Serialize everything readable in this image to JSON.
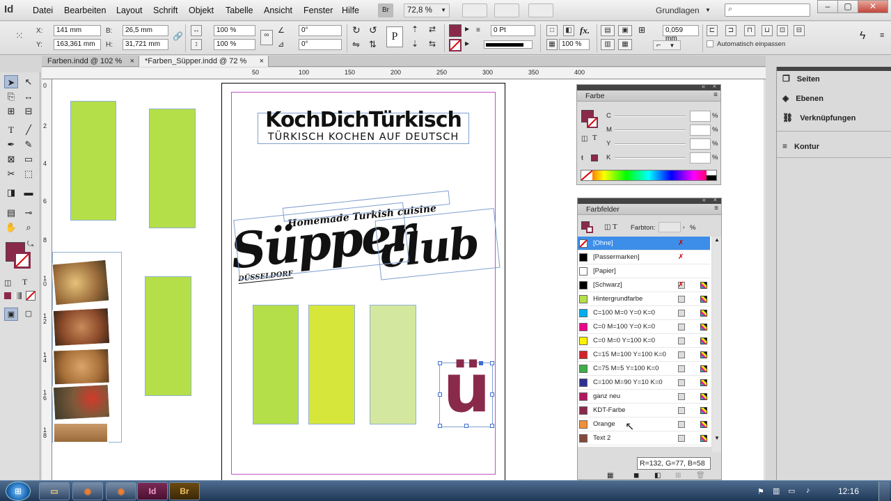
{
  "app": {
    "logo": "Id"
  },
  "menu": [
    "Datei",
    "Bearbeiten",
    "Layout",
    "Schrift",
    "Objekt",
    "Tabelle",
    "Ansicht",
    "Fenster",
    "Hilfe"
  ],
  "menubar": {
    "bridge_label": "Br",
    "zoom": "72,8 %",
    "workspace": "Grundlagen",
    "search_placeholder": ""
  },
  "control": {
    "x_label": "X:",
    "x_value": "141 mm",
    "y_label": "Y:",
    "y_value": "163,361 mm",
    "w_label": "B:",
    "w_value": "26,5 mm",
    "h_label": "H:",
    "h_value": "31,721 mm",
    "scale_x": "100 %",
    "scale_y": "100 %",
    "angle": "0°",
    "shear": "0°",
    "stroke_weight": "0 Pt",
    "opacity": "100 %",
    "offset": "0,059 mm",
    "autofit_label": "Automatisch einpassen"
  },
  "tabs": [
    {
      "label": "Farben.indd @ 102 %"
    },
    {
      "label": "*Farben_Süpper.indd @ 72 %"
    }
  ],
  "ruler_top": [
    "50",
    "100",
    "150",
    "200",
    "250",
    "300",
    "350",
    "400"
  ],
  "ruler_left": [
    "0",
    "2",
    "4",
    "6",
    "8",
    "1 0",
    "1 2",
    "1 4",
    "1 6",
    "1 8"
  ],
  "document": {
    "title": "KochDichTürkisch",
    "subtitle": "TÜRKISCH KOCHEN AUF DEUTSCH",
    "tagline": "Homemade Turkish cuisine",
    "logo_main": "Süpper",
    "logo_sub": "club",
    "city": "DÜSSELDORF",
    "glyph": "ü"
  },
  "color_panel": {
    "title": "Farbe",
    "channels": [
      "C",
      "M",
      "Y",
      "K"
    ],
    "percent": "%"
  },
  "swatches_panel": {
    "title": "Farbfelder",
    "tint_label": "Farbton:",
    "tint_unit": "%",
    "tooltip": "R=132, G=77, B=58",
    "items": [
      {
        "name": "[Ohne]",
        "color": "#ffffff",
        "selected": true
      },
      {
        "name": "[Passermarken]",
        "color": "#000000"
      },
      {
        "name": "[Papier]",
        "color": "#ffffff"
      },
      {
        "name": "[Schwarz]",
        "color": "#000000"
      },
      {
        "name": "Hintergrundfarbe",
        "color": "#b5df48"
      },
      {
        "name": "C=100 M=0 Y=0 K=0",
        "color": "#00aeef"
      },
      {
        "name": "C=0 M=100 Y=0 K=0",
        "color": "#ec008c"
      },
      {
        "name": "C=0 M=0 Y=100 K=0",
        "color": "#fff200"
      },
      {
        "name": "C=15 M=100 Y=100 K=0",
        "color": "#d2232a"
      },
      {
        "name": "C=75 M=5 Y=100 K=0",
        "color": "#3fae49"
      },
      {
        "name": "C=100 M=90 Y=10 K=0",
        "color": "#2e3192"
      },
      {
        "name": "ganz neu",
        "color": "#b0195e"
      },
      {
        "name": "KDT-Farbe",
        "color": "#8a2a4a"
      },
      {
        "name": "Orange",
        "color": "#f0913a"
      },
      {
        "name": "Text 2",
        "color": "#84493a"
      }
    ]
  },
  "dock": [
    "Seiten",
    "Ebenen",
    "Verknüpfungen",
    "Kontur"
  ],
  "taskbar": {
    "time": "12:16",
    "id_label": "Id",
    "br_label": "Br"
  }
}
